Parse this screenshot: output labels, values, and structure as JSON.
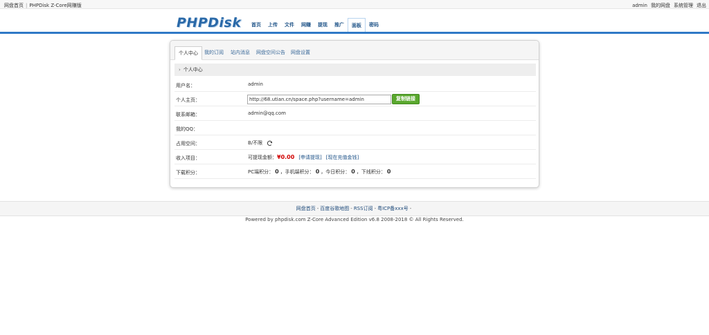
{
  "topbar": {
    "home": "网盘首页",
    "separator": "|",
    "product": "PHPDisk Z-Core网赚版",
    "user": "admin",
    "my_disk": "我的网盘",
    "admin_panel": "系统管理",
    "logout": "退出"
  },
  "header": {
    "logo": "PHPDisk",
    "nav": [
      "首页",
      "上传",
      "文件",
      "网赚",
      "提现",
      "推广",
      "面板",
      "密码"
    ],
    "active_nav": "面板"
  },
  "panel": {
    "tabs": [
      "个人中心",
      "我的订阅",
      "站内消息",
      "网盘空间公告",
      "网盘设置"
    ],
    "section_title": "个人中心",
    "rows": {
      "username": {
        "label": "用户名：",
        "value": "admin"
      },
      "homepage": {
        "label": "个人主页：",
        "url": "http://68.utian.cn/space.php?username=admin",
        "button": "复制链接"
      },
      "email": {
        "label": "联系邮箱：",
        "value": "admin@qq.com"
      },
      "qq": {
        "label": "我的QQ：",
        "value": ""
      },
      "space": {
        "label": "占用空间：",
        "value": "B/不限"
      },
      "income": {
        "label": "收入项目：",
        "prefix": "可提现金额：",
        "amount": "¥0.00",
        "apply": "[申请提现]",
        "recharge": "[现在充值金钱]"
      },
      "points": {
        "label": "下载积分：",
        "pc_label": "PC端积分：",
        "pc": "0",
        "mobile_label": "，手机端积分：",
        "mobile": "0",
        "today_label": "，今日积分：",
        "today": "0",
        "downline_label": "，下线积分：",
        "downline": "0"
      }
    }
  },
  "footer": {
    "links": [
      "网盘首页",
      "百度谷歌地图",
      "RSS订阅",
      "粤ICP备xxx号"
    ],
    "dash": "-",
    "copyright": "Powered by phpdisk.com Z-Core Advanced Edition v6.8 2008-2018 © All Rights Reserved."
  },
  "colors": {
    "brand_blue": "#2f79c6",
    "button_green": "#5aa82e",
    "money_red": "#d00000"
  }
}
